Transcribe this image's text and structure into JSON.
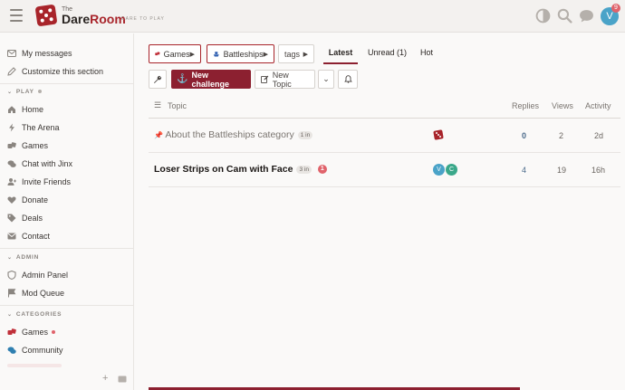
{
  "header": {
    "logo_the": "The",
    "logo_name_a": "Dare",
    "logo_name_b": "Room",
    "tagline": "DARE TO PLAY",
    "avatar_letter": "V",
    "notification_count": "9"
  },
  "sidebar": {
    "top_items": [
      {
        "label": "My messages",
        "icon": "envelope-icon"
      },
      {
        "label": "Customize this section",
        "icon": "pencil-icon"
      }
    ],
    "play_heading": "PLAY",
    "play_items": [
      {
        "label": "Home",
        "icon": "home-icon"
      },
      {
        "label": "The Arena",
        "icon": "bolt-icon"
      },
      {
        "label": "Games",
        "icon": "dice-icon"
      },
      {
        "label": "Chat with Jinx",
        "icon": "chat-icon"
      },
      {
        "label": "Invite Friends",
        "icon": "user-plus-icon"
      },
      {
        "label": "Donate",
        "icon": "heart-icon"
      },
      {
        "label": "Deals",
        "icon": "tag-icon"
      },
      {
        "label": "Contact",
        "icon": "envelope-icon"
      }
    ],
    "admin_heading": "ADMIN",
    "admin_items": [
      {
        "label": "Admin Panel",
        "icon": "shield-icon"
      },
      {
        "label": "Mod Queue",
        "icon": "flag-icon"
      }
    ],
    "categories_heading": "CATEGORIES",
    "category_items": [
      {
        "label": "Games",
        "icon": "dice-icon"
      },
      {
        "label": "Community",
        "icon": "chat-icon"
      }
    ]
  },
  "toolbar": {
    "crumb_games": "Games",
    "crumb_battleships": "Battleships",
    "crumb_tags": "tags",
    "tab_latest": "Latest",
    "tab_unread": "Unread (1)",
    "tab_hot": "Hot",
    "new_challenge": "New challenge",
    "new_topic": "New Topic"
  },
  "table": {
    "col_topic": "Topic",
    "col_replies": "Replies",
    "col_views": "Views",
    "col_activity": "Activity",
    "rows": [
      {
        "title": "About the Battleships category",
        "count_badge": "1 in",
        "replies": "0",
        "views": "2",
        "activity": "2d"
      },
      {
        "title": "Loser Strips on Cam with Face",
        "count_badge": "3 in",
        "unread": "1",
        "replies": "4",
        "views": "19",
        "activity": "16h",
        "avatars": [
          "V",
          "C"
        ]
      }
    ]
  },
  "colors": {
    "brand": "#a8242a",
    "brand_dark": "#8c2030",
    "avatar_v": "#4aa3c8",
    "avatar_c": "#3aa88a"
  }
}
